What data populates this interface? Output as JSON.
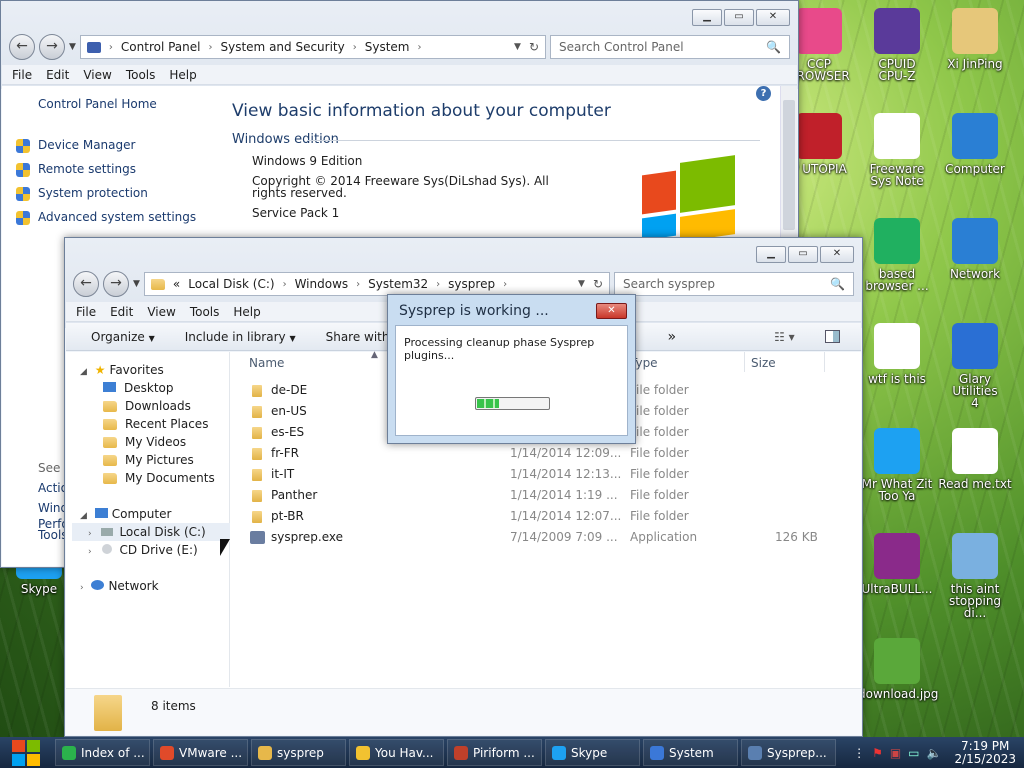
{
  "desktop": {
    "icons": [
      {
        "label": "CCP\nBROWSER",
        "color": "#e84a8a"
      },
      {
        "label": "CPUID\nCPU-Z",
        "color": "#5a3a9a"
      },
      {
        "label": "Xi JinPing",
        "color": "#e6c77a"
      },
      {
        "label": "P UTOPIA",
        "color": "#c0202a"
      },
      {
        "label": "Freeware\nSys Note",
        "color": "#ffffff"
      },
      {
        "label": "Computer",
        "color": "#2a7fd4"
      },
      {
        "label": "based\nbrowser ...",
        "color": "#20b060"
      },
      {
        "label": "Network",
        "color": "#2a7fd4"
      },
      {
        "label": "wtf is this",
        "color": "#ffffff"
      },
      {
        "label": "Glary Utilities\n4",
        "color": "#2a6fd4"
      },
      {
        "label": "Mr What Zit\nToo Ya",
        "color": "#1da1f2"
      },
      {
        "label": "Read me.txt",
        "color": "#ffffff"
      },
      {
        "label": "UltraBULL...",
        "color": "#8a2a8a"
      },
      {
        "label": "this aint\nstopping di...",
        "color": "#7ab0e0"
      },
      {
        "label": "download.jpg",
        "color": "#5aa83a"
      },
      {
        "label": "Skype",
        "color": "#1da1f2"
      }
    ]
  },
  "cp": {
    "breadcrumb": [
      "Control Panel",
      "System and Security",
      "System"
    ],
    "search_placeholder": "Search Control Panel",
    "menu": [
      "File",
      "Edit",
      "View",
      "Tools",
      "Help"
    ],
    "side_home": "Control Panel Home",
    "side_links": [
      "Device Manager",
      "Remote settings",
      "System protection",
      "Advanced system settings"
    ],
    "side_bottom": [
      "See",
      "Actio",
      "Wind",
      "Perfo",
      "Tools"
    ],
    "heading": "View basic information about your computer",
    "section": "Windows edition",
    "edition": "Windows 9 Edition",
    "copyright": "Copyright © 2014 Freeware Sys(DiLshad Sys).  All rights reserved.",
    "service_pack": "Service Pack 1"
  },
  "ex": {
    "address_prefix": "«",
    "breadcrumb": [
      "Local Disk (C:)",
      "Windows",
      "System32",
      "sysprep"
    ],
    "search_placeholder": "Search sysprep",
    "menu": [
      "File",
      "Edit",
      "View",
      "Tools",
      "Help"
    ],
    "toolbar": {
      "organize": "Organize",
      "include": "Include in library",
      "share": "Share with",
      "more": "»"
    },
    "nav": {
      "favorites": "Favorites",
      "fav_items": [
        "Desktop",
        "Downloads",
        "Recent Places",
        "My Videos",
        "My Pictures",
        "My Documents"
      ],
      "computer": "Computer",
      "drives": [
        "Local Disk (C:)",
        "CD Drive (E:)"
      ],
      "network": "Network"
    },
    "columns": {
      "name": "Name",
      "type": "Type",
      "size": "Size"
    },
    "files": [
      {
        "name": "de-DE",
        "date": "",
        "type": "File folder",
        "size": "",
        "kind": "folder"
      },
      {
        "name": "en-US",
        "date": "",
        "type": "File folder",
        "size": "",
        "kind": "folder"
      },
      {
        "name": "es-ES",
        "date": "",
        "type": "File folder",
        "size": "",
        "kind": "folder"
      },
      {
        "name": "fr-FR",
        "date": "1/14/2014 12:09...",
        "type": "File folder",
        "size": "",
        "kind": "folder"
      },
      {
        "name": "it-IT",
        "date": "1/14/2014 12:13...",
        "type": "File folder",
        "size": "",
        "kind": "folder"
      },
      {
        "name": "Panther",
        "date": "1/14/2014 1:19 ...",
        "type": "File folder",
        "size": "",
        "kind": "folder"
      },
      {
        "name": "pt-BR",
        "date": "1/14/2014 12:07...",
        "type": "File folder",
        "size": "",
        "kind": "folder"
      },
      {
        "name": "sysprep.exe",
        "date": "7/14/2009 7:09 ...",
        "type": "Application",
        "size": "126 KB",
        "kind": "app"
      }
    ],
    "status": "8 items"
  },
  "dialog": {
    "title": "Sysprep is working ...",
    "message": "Processing cleanup phase Sysprep plugins...",
    "progress": 0.3
  },
  "taskbar": {
    "items": [
      {
        "label": "Index of ...",
        "color": "#2bb24c"
      },
      {
        "label": "VMware ...",
        "color": "#e04a2a"
      },
      {
        "label": "sysprep",
        "color": "#e7b84a"
      },
      {
        "label": "You Hav...",
        "color": "#f2c230"
      },
      {
        "label": "Piriform ...",
        "color": "#c0402a"
      },
      {
        "label": "Skype",
        "color": "#1da1f2"
      },
      {
        "label": "System",
        "color": "#3b78d8"
      },
      {
        "label": "Sysprep...",
        "color": "#5a7fb0"
      }
    ],
    "time": "7:19 PM",
    "date": "2/15/2023"
  }
}
